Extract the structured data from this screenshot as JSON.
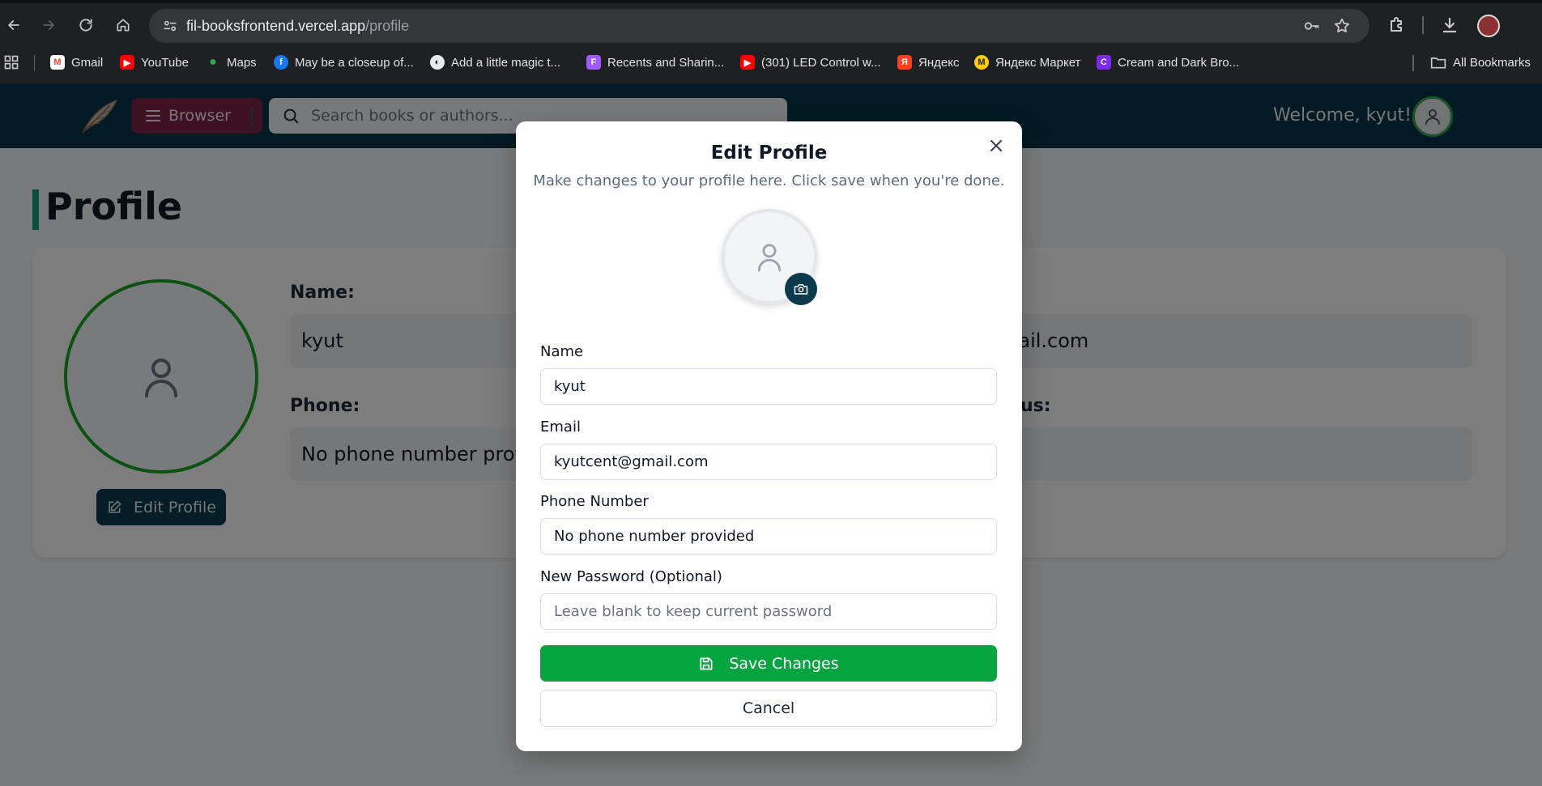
{
  "browser": {
    "url_host": "fil-booksfrontend.vercel.app",
    "url_path": "/profile",
    "bookmarks": [
      {
        "label": "Gmail",
        "icon": "gmail-icon",
        "color": "#ea4335"
      },
      {
        "label": "YouTube",
        "icon": "youtube-icon",
        "color": "#ff0000"
      },
      {
        "label": "Maps",
        "icon": "maps-icon",
        "color": "#34a853"
      },
      {
        "label": "May be a closeup of...",
        "icon": "facebook-icon",
        "color": "#1877f2"
      },
      {
        "label": "Add a little magic t...",
        "icon": "globe-icon",
        "color": "#5f6368"
      },
      {
        "label": "Recents and Sharin...",
        "icon": "figma-icon",
        "color": "#a259ff"
      },
      {
        "label": "(301) LED Control w...",
        "icon": "youtube-icon",
        "color": "#ff0000"
      },
      {
        "label": "Яндекс",
        "icon": "yandex-icon",
        "color": "#fc3f1d"
      },
      {
        "label": "Яндекс Маркет",
        "icon": "yandex-market-icon",
        "color": "#ffcc00"
      },
      {
        "label": "Cream and Dark Bro...",
        "icon": "canva-icon",
        "color": "#7d2ae8"
      }
    ],
    "all_bookmarks_label": "All Bookmarks"
  },
  "header": {
    "browser_button_label": "Browser",
    "search_placeholder": "Search books or authors...",
    "welcome_text": "Welcome, kyut!"
  },
  "page": {
    "title": "Profile",
    "edit_profile_label": "Edit Profile",
    "fields": {
      "name_label": "Name:",
      "name_value": "kyut",
      "email_value_partial": "mail.com",
      "phone_label": "Phone:",
      "phone_value": "No phone number prov",
      "status_label_partial": "us:"
    }
  },
  "modal": {
    "title": "Edit Profile",
    "description": "Make changes to your profile here. Click save when you're done.",
    "name_label": "Name",
    "name_value": "kyut",
    "email_label": "Email",
    "email_value": "kyutcent@gmail.com",
    "phone_label": "Phone Number",
    "phone_value": "No phone number provided",
    "password_label": "New Password (Optional)",
    "password_placeholder": "Leave blank to keep current password",
    "save_label": "Save Changes",
    "cancel_label": "Cancel"
  },
  "colors": {
    "header_bg": "#043447",
    "browser_button_bg": "#7a2447",
    "save_green": "#05a441",
    "avatar_ring_green": "#17a320",
    "title_accent": "#119b7a"
  }
}
